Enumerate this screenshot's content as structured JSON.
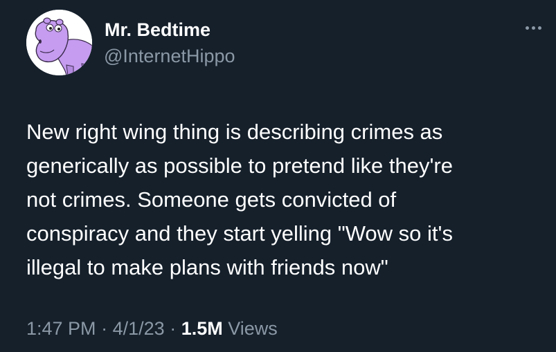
{
  "author": {
    "display_name": "Mr. Bedtime",
    "handle": "@InternetHippo",
    "avatar_icon": "purple-hippo-avatar"
  },
  "more_icon": "more-options-icon",
  "tweet": {
    "text": "New right wing thing is describing crimes as\ngenerically as possible to pretend like they're\nnot crimes. Someone gets convicted of\nconspiracy and they start yelling \"Wow so it's\nillegal to make plans with friends now\""
  },
  "meta": {
    "time": "1:47 PM",
    "separator": "·",
    "date": "4/1/23",
    "views_count": "1.5M",
    "views_label": "Views"
  },
  "colors": {
    "background": "#15202b",
    "primary_text": "#ffffff",
    "secondary_text": "#8b98a5",
    "avatar_hippo": "#c59cf0"
  }
}
